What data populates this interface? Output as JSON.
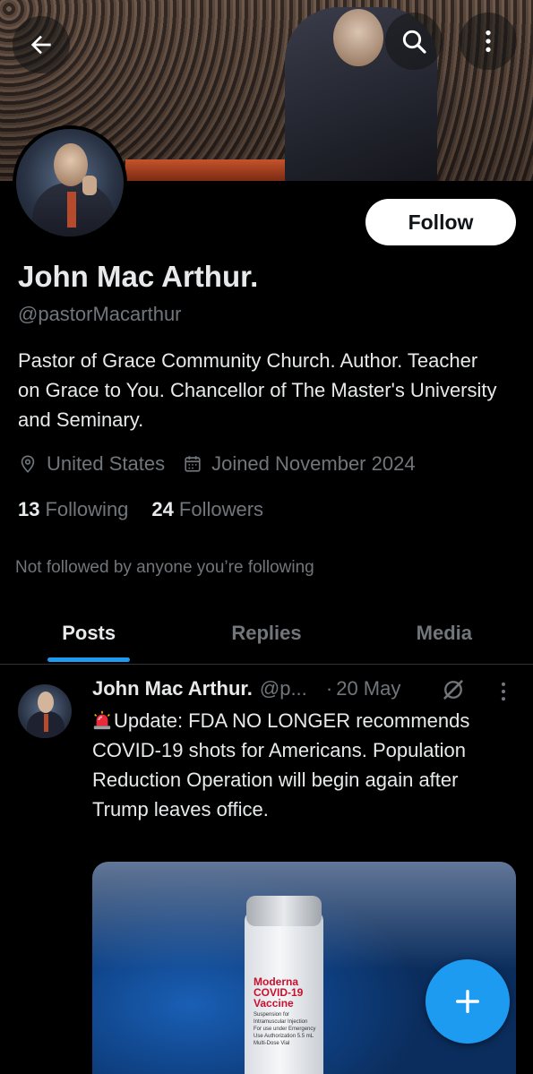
{
  "profile": {
    "display_name": "John Mac Arthur.",
    "handle": "@pastorMacarthur",
    "bio": "Pastor of Grace Community Church. Author. Teacher on Grace to You. Chancellor of The Master's University and Seminary.",
    "location": "United States",
    "joined": "Joined November 2024",
    "following_count": "13",
    "following_label": "Following",
    "followers_count": "24",
    "followers_label": "Followers",
    "not_followed_text": "Not followed by anyone you’re following"
  },
  "actions": {
    "follow_label": "Follow"
  },
  "tabs": [
    {
      "label": "Posts",
      "active": true
    },
    {
      "label": "Replies",
      "active": false
    },
    {
      "label": "Media",
      "active": false
    }
  ],
  "post": {
    "author": "John Mac Arthur.",
    "handle": "@p...",
    "separator": "·",
    "time": "20 May",
    "text": "Update: FDA NO LONGER recommends COVID-19 shots for Americans. Population Reduction Operation will begin again after Trump leaves office.",
    "media": {
      "vial_brand": "Moderna",
      "vial_name_line1": "COVID-19",
      "vial_name_line2": "Vaccine",
      "vial_fine_print": "Suspension for Intramuscular Injection For use under Emergency Use Authorization 5.5 mL Multi-Dose Vial"
    }
  },
  "icons": {
    "back": "arrow-left-icon",
    "search": "search-icon",
    "more": "more-vertical-icon",
    "location": "location-pin-icon",
    "calendar": "calendar-icon",
    "grok": "grok-icon",
    "siren": "rotating-light-icon",
    "compose": "plus-icon"
  },
  "colors": {
    "background": "#000000",
    "primary_text": "#e7e9ea",
    "secondary_text": "#71767b",
    "accent": "#1d9bf0",
    "follow_button_bg": "#ffffff"
  }
}
